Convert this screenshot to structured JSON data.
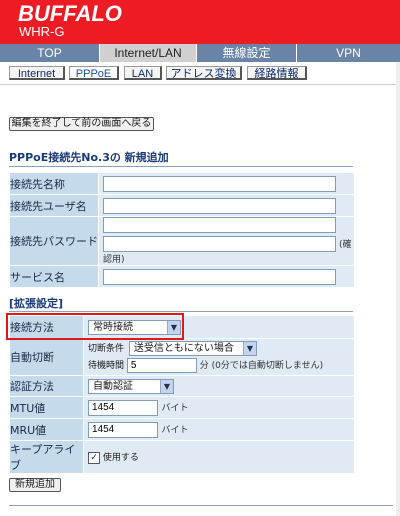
{
  "header": {
    "brand": "BUFFALO",
    "model": "WHR-G"
  },
  "tabs": [
    {
      "label": "TOP",
      "active": false
    },
    {
      "label": "Internet/LAN",
      "active": true
    },
    {
      "label": "無線設定",
      "active": false
    },
    {
      "label": "VPN",
      "active": false
    }
  ],
  "subtabs": [
    {
      "label": "Internet",
      "active": false
    },
    {
      "label": "PPPoE",
      "active": true
    },
    {
      "label": "LAN",
      "active": false
    },
    {
      "label": "アドレス変換",
      "active": false
    },
    {
      "label": "経路情報",
      "active": false
    }
  ],
  "back_button": "編集を終了して前の画面へ戻る",
  "page_title": "PPPoE接続先No.3の 新規追加",
  "basic": {
    "conn_name_label": "接続先名称",
    "user_label": "接続先ユーザ名",
    "password_label": "接続先パスワード",
    "password_confirm_note": "(確認用)",
    "service_label": "サービス名",
    "conn_name_value": "",
    "user_value": "",
    "password_value": "",
    "password_confirm_value": "",
    "service_value": ""
  },
  "extended_title": "[拡張設定]",
  "extended": {
    "method_label": "接続方法",
    "method_value": "常時接続",
    "auto_disconnect_label": "自動切断",
    "condition_label": "切断条件",
    "condition_value": "送受信ともにない場合",
    "wait_label": "待機時間",
    "wait_value": "5",
    "wait_note": "分 (0分では自動切断しません)",
    "auth_label": "認証方法",
    "auth_value": "自動認証",
    "mtu_label": "MTU値",
    "mtu_value": "1454",
    "mtu_unit": "バイト",
    "mru_label": "MRU値",
    "mru_value": "1454",
    "mru_unit": "バイト",
    "keepalive_label": "キープアライブ",
    "keepalive_checked": true,
    "keepalive_text": "使用する"
  },
  "add_button": "新規追加",
  "colors": {
    "header_red": "#ed1c24",
    "tab_blue": "#6a84a8",
    "label_bg": "#c5daea",
    "highlight_box": "#e01818"
  }
}
